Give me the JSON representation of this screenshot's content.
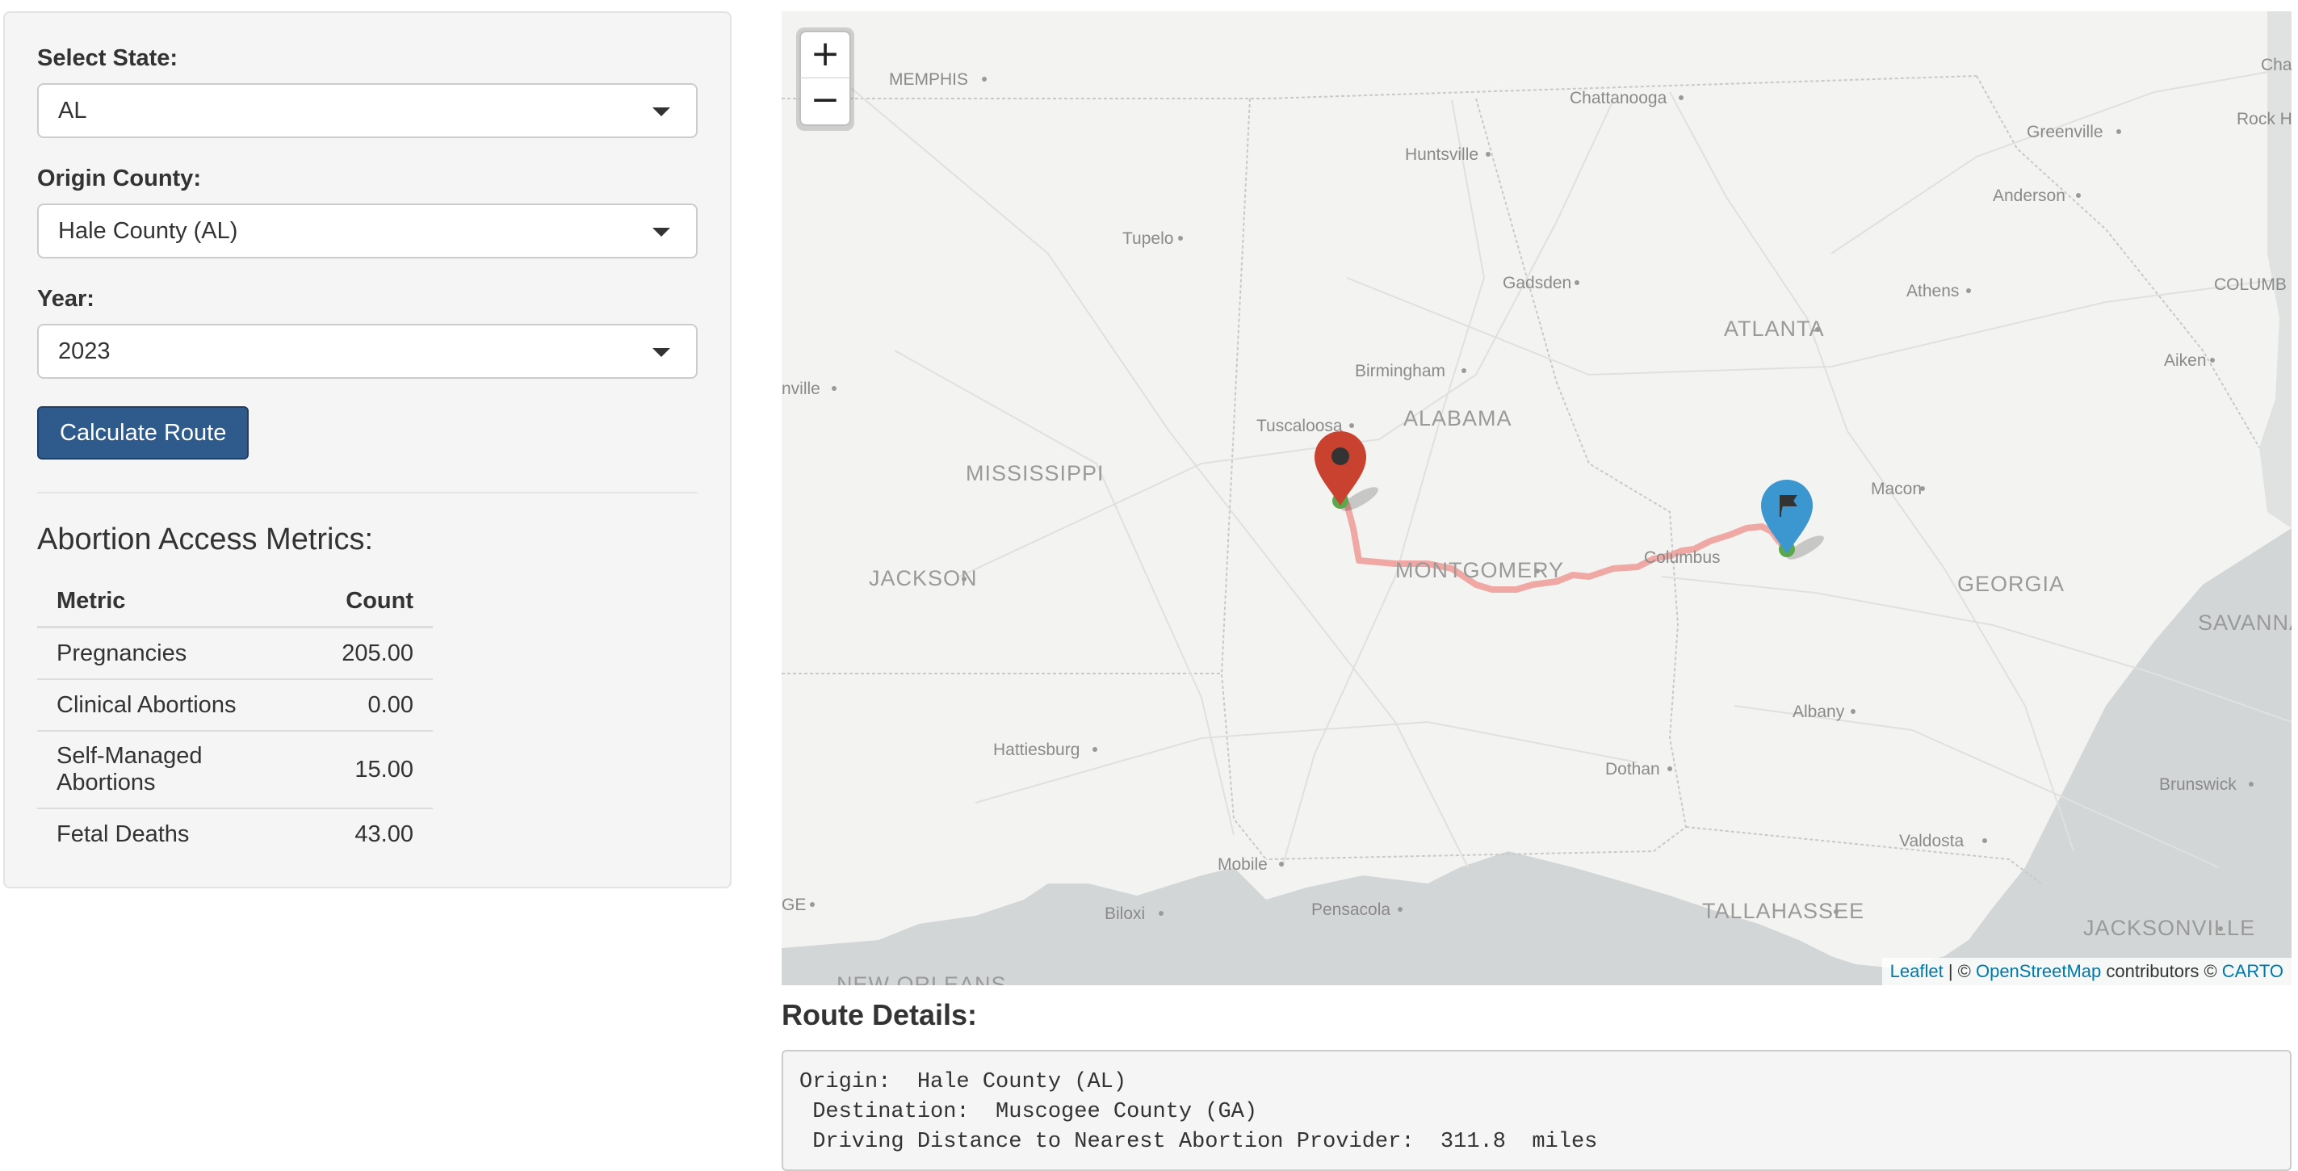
{
  "sidebar": {
    "state_label": "Select State:",
    "state_value": "AL",
    "county_label": "Origin County:",
    "county_value": "Hale County (AL)",
    "year_label": "Year:",
    "year_value": "2023",
    "calculate_button": "Calculate Route",
    "metrics_title": "Abortion Access Metrics:",
    "metrics_headers": [
      "Metric",
      "Count"
    ],
    "metrics_rows": [
      {
        "metric": "Pregnancies",
        "count": "205.00"
      },
      {
        "metric": "Clinical Abortions",
        "count": "0.00"
      },
      {
        "metric": "Self-Managed Abortions",
        "count": "15.00"
      },
      {
        "metric": "Fetal Deaths",
        "count": "43.00"
      }
    ]
  },
  "map": {
    "zoom_in": "+",
    "zoom_out": "−",
    "origin_marker_icon": "map-pin-icon",
    "destination_marker_icon": "flag-icon",
    "route_color": "#f0a8a4",
    "origin_marker_color": "#c9412f",
    "destination_marker_color": "#3c96d0",
    "state_labels": {
      "mississippi": "MISSISSIPPI",
      "alabama": "ALABAMA",
      "georgia": "GEORGIA"
    },
    "cities": {
      "memphis": "MEMPHIS",
      "chattanooga": "Chattanooga",
      "huntsville": "Huntsville",
      "tupelo": "Tupelo",
      "gadsden": "Gadsden",
      "birmingham": "Birmingham",
      "atlanta": "ATLANTA",
      "athens": "Athens",
      "greenville": "Greenville",
      "anderson": "Anderson",
      "rock_hill": "Rock H",
      "charlotte": "Cha",
      "columbia": "COLUMB",
      "aiken": "Aiken",
      "tuscaloosa": "Tuscaloosa",
      "nashville_partial": "nville",
      "macon": "Macon",
      "jackson": "JACKSON",
      "montgomery": "MONTGOMERY",
      "columbus": "Columbus",
      "savannah": "SAVANNA",
      "albany": "Albany",
      "hattiesburg": "Hattiesburg",
      "dothan": "Dothan",
      "brunswick": "Brunswick",
      "valdosta": "Valdosta",
      "mobile": "Mobile",
      "biloxi": "Biloxi",
      "pensacola": "Pensacola",
      "tallahassee": "TALLAHASSEE",
      "jacksonville": "JACKSONVILLE",
      "new_orleans_partial": "NEW ORLEANS",
      "baton_rouge_partial": "GE"
    },
    "attribution": {
      "leaflet": "Leaflet",
      "sep1": " | © ",
      "osm": "OpenStreetMap",
      "contrib": " contributors © ",
      "carto": "CARTO"
    }
  },
  "route": {
    "title": "Route Details:",
    "lines": [
      "Origin:  Hale County (AL)",
      " Destination:  Muscogee County (GA)",
      " Driving Distance to Nearest Abortion Provider:  311.8  miles"
    ]
  }
}
